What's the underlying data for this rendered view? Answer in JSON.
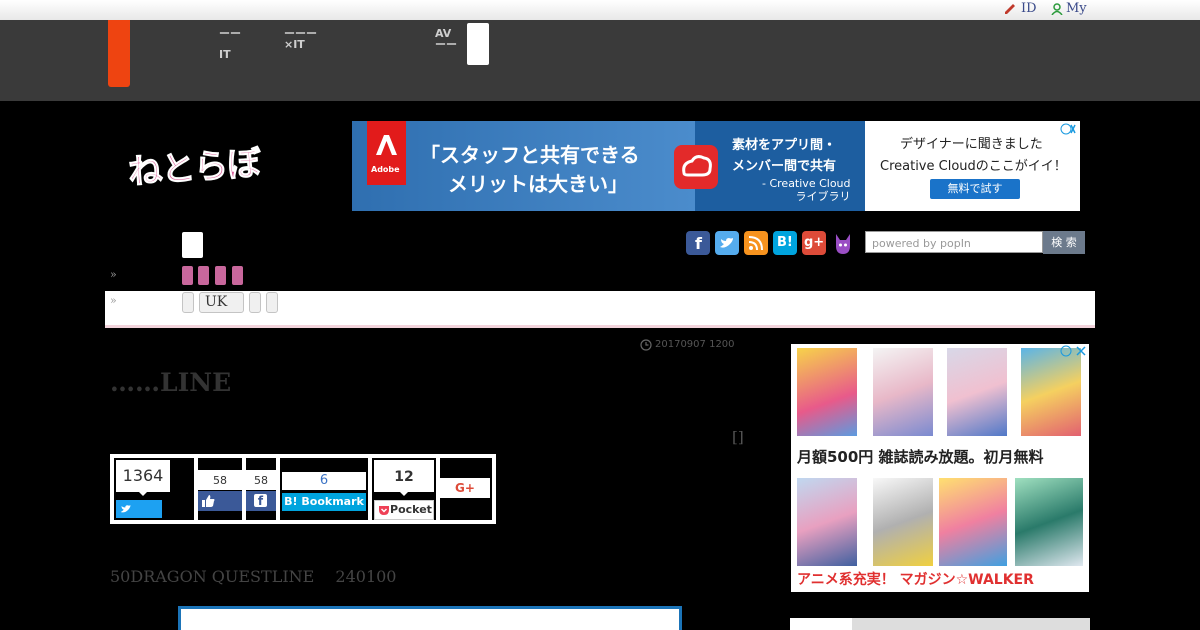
{
  "topbar": {
    "id_label": "ID",
    "my_label": "My"
  },
  "header": {
    "nav": [
      {
        "line1": "ーー",
        "line2": "IT"
      },
      {
        "line1": "ーーー",
        "line2": "×IT"
      },
      {
        "line1": "AV",
        "line2": "ーー"
      }
    ]
  },
  "logo": {
    "text": "ねとらぼ"
  },
  "ad_banner": {
    "headline": "「スタッフと共有できる",
    "headline2": "メリットは大きい」",
    "mid_line1": "素材をアプリ間・",
    "mid_line2": "メンバー間で共有",
    "mid_line3": "- Creative Cloud",
    "mid_line4": "ライブラリ",
    "right_line1": "デザイナーに聞きました",
    "right_line2": "Creative Cloudのここがイイ！",
    "button": "無料で試す",
    "brand": "Adobe"
  },
  "search": {
    "placeholder": "powered by popIn",
    "button": "検 索"
  },
  "social_icons": [
    "facebook-icon",
    "twitter-icon",
    "rss-icon",
    "hatena-icon",
    "googleplus-icon",
    "cat-icon"
  ],
  "nav_rows": {
    "raquo": "»",
    "uk_label": "UK"
  },
  "article": {
    "date": "20170907 1200",
    "title": "……LINE",
    "bracket": "[]",
    "lead": "50DRAGON QUESTLINE　 240100"
  },
  "share": {
    "twitter_count": "1364",
    "fb_like_count": "58",
    "fb_share_count": "58",
    "hatena_count": "6",
    "hatena_label": "B! Bookmark",
    "pocket_count": "12",
    "pocket_label": "Pocket",
    "gplus_label": "G+"
  },
  "side_ad": {
    "price_text": "月額500円 雑誌読み放題。初月無料",
    "footer_text": "アニメ系充実！ マガジン☆WALKER"
  }
}
